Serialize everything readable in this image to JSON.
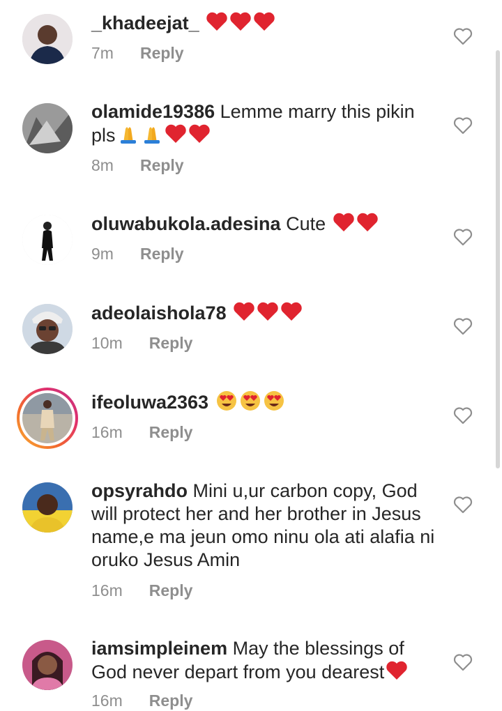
{
  "comments": [
    {
      "username": "_khadeejat_",
      "text": "",
      "emojis": [
        "red-heart",
        "red-heart",
        "red-heart"
      ],
      "time": "7m",
      "reply": "Reply"
    },
    {
      "username": "olamide19386",
      "text": "Lemme marry this pikin pls",
      "emojis": [
        "folded-hands",
        "folded-hands",
        "red-heart",
        "red-heart"
      ],
      "time": "8m",
      "reply": "Reply"
    },
    {
      "username": "oluwabukola.adesina",
      "text": "Cute",
      "emojis": [
        "red-heart",
        "red-heart"
      ],
      "time": "9m",
      "reply": "Reply"
    },
    {
      "username": "adeolaishola78",
      "text": "",
      "emojis": [
        "red-heart",
        "red-heart",
        "red-heart"
      ],
      "time": "10m",
      "reply": "Reply"
    },
    {
      "username": "ifeoluwa2363",
      "text": "",
      "emojis": [
        "heart-eyes",
        "heart-eyes",
        "heart-eyes"
      ],
      "time": "16m",
      "reply": "Reply"
    },
    {
      "username": "opsyrahdo",
      "text": "Mini u,ur carbon copy, God will protect her and her brother in Jesus name,e ma jeun omo ninu ola ati alafia ni oruko Jesus Amin",
      "emojis": [],
      "time": "16m",
      "reply": "Reply"
    },
    {
      "username": "iamsimpleinem",
      "text": "May the blessings of God never depart from you dearest",
      "emojis": [
        "red-heart"
      ],
      "time": "16m",
      "reply": "Reply"
    }
  ],
  "icons": {
    "like": "heart-outline-icon"
  },
  "colors": {
    "text": "#262626",
    "muted": "#8e8e8e",
    "heart": "#e0242f"
  }
}
